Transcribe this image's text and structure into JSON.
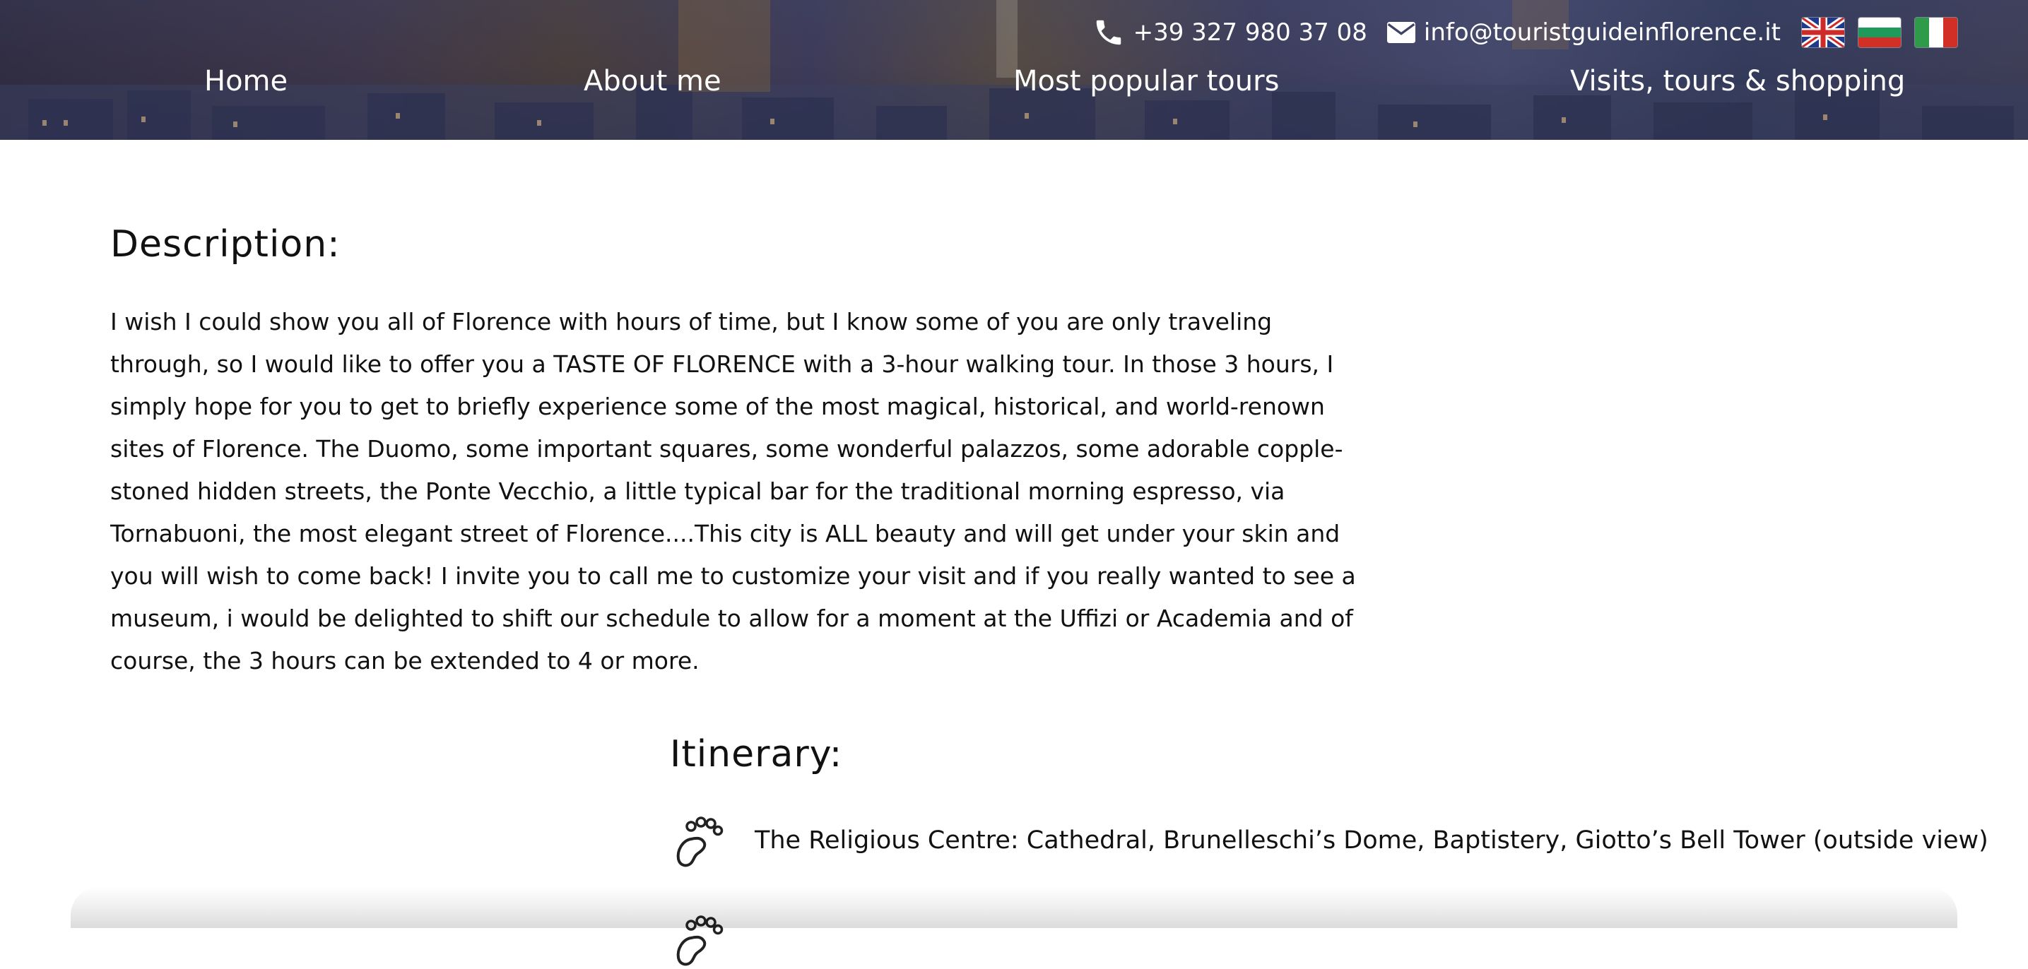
{
  "header": {
    "phone": "+39 327 980 37 08",
    "email": "info@touristguideinflorence.it",
    "flags": [
      {
        "name": "uk-flag-icon"
      },
      {
        "name": "bulgaria-flag-icon"
      },
      {
        "name": "italy-flag-icon"
      }
    ]
  },
  "nav": {
    "items": [
      {
        "label": "Home"
      },
      {
        "label": "About me"
      },
      {
        "label": "Most popular tours"
      },
      {
        "label": "Visits, tours & shopping"
      }
    ]
  },
  "description": {
    "title": "Description:",
    "text": "I wish I could show you all of Florence with hours of time, but I know some of you are only traveling through, so I would like to offer you a TASTE OF FLORENCE with a 3-hour walking tour. In those 3 hours, I simply hope for you to get to briefly experience some of the most magical, historical, and world-renown sites of Florence. The Duomo, some important squares, some wonderful palazzos, some adorable copple-stoned hidden streets, the Ponte Vecchio, a little typical bar for the traditional morning espresso, via Tornabuoni, the most elegant street of Florence....This city is ALL beauty and will get under your skin and you will wish to come back! I invite you to call me to customize your visit and if you really wanted to see a museum, i would be delighted to shift our schedule to allow for a moment at the Uffizi or Academia and of course, the 3 hours can be extended to 4 or more."
  },
  "itinerary": {
    "title": "Itinerary:",
    "items": [
      {
        "icon": "footprint-icon",
        "text": "The Religious Centre: Cathedral, Brunelleschi’s Dome, Baptistery, Giotto’s Bell Tower (outside view)"
      },
      {
        "icon": "footprint-icon",
        "text": ""
      }
    ]
  },
  "colors": {
    "header_text": "#ffffff",
    "body_text": "#111111",
    "background": "#ffffff"
  }
}
